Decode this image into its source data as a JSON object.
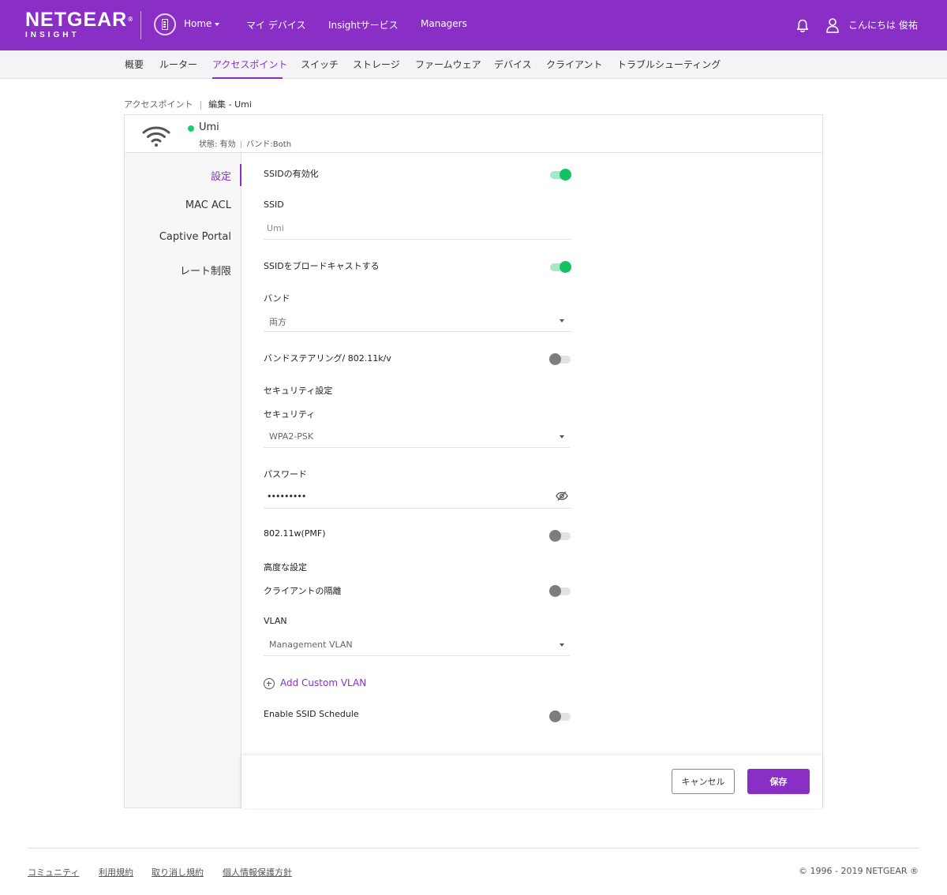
{
  "header": {
    "brand": "NETGEAR",
    "brand_mark": "®",
    "product": "INSIGHT",
    "home_label": "Home",
    "nav": [
      "マイ デバイス",
      "Insightサービス",
      "Managers"
    ],
    "greeting": "こんにちは 俊祐"
  },
  "subnav": {
    "items": [
      "概要",
      "ルーター",
      "アクセスポイント",
      "スイッチ",
      "ストレージ",
      "ファームウェア",
      "デバイス",
      "クライアント",
      "トラブルシューティング"
    ],
    "active": "アクセスポイント"
  },
  "breadcrumb": {
    "parent": "アクセスポイント",
    "sep": "|",
    "current": "編集 - Umi"
  },
  "ap": {
    "name": "Umi",
    "status": "状態: 有効",
    "sep": "|",
    "band": "バンド:Both"
  },
  "sidebar": {
    "items": [
      "設定",
      "MAC ACL",
      "Captive Portal",
      "レート制限"
    ],
    "active": "設定"
  },
  "form": {
    "ssid_enable_label": "SSIDの有効化",
    "ssid_enable": true,
    "ssid_label": "SSID",
    "ssid_value": "Umi",
    "broadcast_label": "SSIDをブロードキャストする",
    "broadcast": true,
    "band_label": "バンド",
    "band_value": "両方",
    "band_steering_label": "バンドステアリング/ 802.11k/v",
    "band_steering": false,
    "security_section": "セキュリティ設定",
    "security_label": "セキュリティ",
    "security_value": "WPA2-PSK",
    "password_label": "パスワード",
    "password_value": "•••••••••",
    "pmf_label": "802.11w(PMF)",
    "pmf": false,
    "advanced_section": "高度な設定",
    "client_isolation_label": "クライアントの隔離",
    "client_isolation": false,
    "vlan_label": "VLAN",
    "vlan_value": "Management VLAN",
    "add_vlan": "Add Custom VLAN",
    "schedule_label": "Enable SSID Schedule",
    "schedule": false
  },
  "actions": {
    "cancel": "キャンセル",
    "save": "保存"
  },
  "footer": {
    "links": [
      "コミュニティ",
      "利用規約",
      "取り消し規約",
      "個人情報保護方針"
    ],
    "copyright": "© 1996 - 2019 NETGEAR ®"
  },
  "colors": {
    "accent": "#8a2fc6",
    "toggle_on": "#14c264",
    "status_active": "#1bcc6b"
  },
  "icons": {
    "home": "building-icon",
    "notify": "bell-icon",
    "user": "user-icon",
    "device": "wifi-icon",
    "password_toggle": "eye-slash-icon",
    "add": "plus-circle-icon"
  }
}
